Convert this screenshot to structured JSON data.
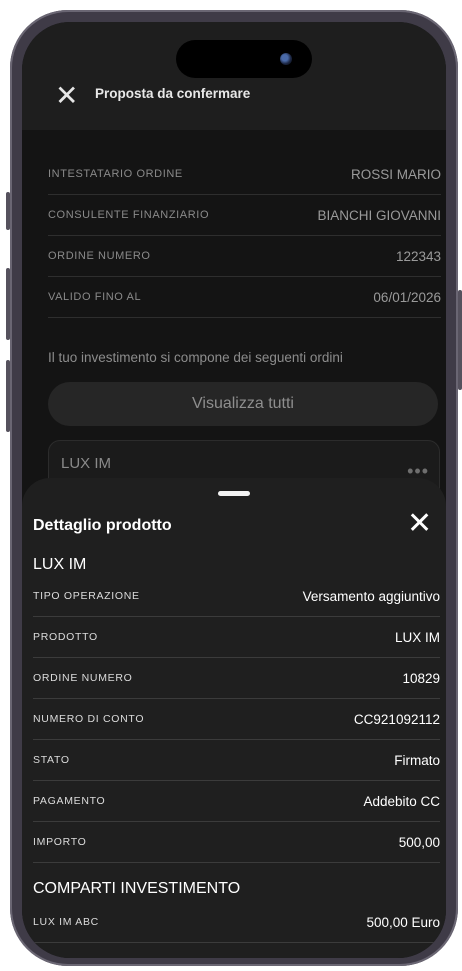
{
  "header": {
    "title": "Proposta da confermare",
    "close_icon": "close-icon"
  },
  "order_info": [
    {
      "label": "INTESTATARIO ORDINE",
      "value": "ROSSI MARIO"
    },
    {
      "label": "CONSULENTE FINANZIARIO",
      "value": "BIANCHI GIOVANNI"
    },
    {
      "label": "ORDINE NUMERO",
      "value": "122343"
    },
    {
      "label": "VALIDO FINO AL",
      "value": "06/01/2026"
    }
  ],
  "intro_text": "Il tuo investimento si compone dei seguenti ordini",
  "view_all_label": "Visualizza tutti",
  "product_card": {
    "name": "LUX IM",
    "more_icon": "more-dots-icon"
  },
  "sheet": {
    "title": "Dettaglio prodotto",
    "product_name": "LUX IM",
    "details": [
      {
        "label": "TIPO OPERAZIONE",
        "value": "Versamento aggiuntivo"
      },
      {
        "label": "PRODOTTO",
        "value": "LUX IM"
      },
      {
        "label": "ORDINE NUMERO",
        "value": "10829"
      },
      {
        "label": "NUMERO DI CONTO",
        "value": "CC921092112"
      },
      {
        "label": "STATO",
        "value": "Firmato"
      },
      {
        "label": "PAGAMENTO",
        "value": "Addebito CC"
      },
      {
        "label": "IMPORTO",
        "value": "500,00"
      }
    ],
    "section_title": "COMPARTI INVESTIMENTO",
    "comparti": [
      {
        "label": "LUX IM ABC",
        "value": "500,00 Euro"
      }
    ]
  },
  "colors": {
    "background": "#141414",
    "sheet": "#1f1f1f",
    "frame": "#3f3b47"
  }
}
